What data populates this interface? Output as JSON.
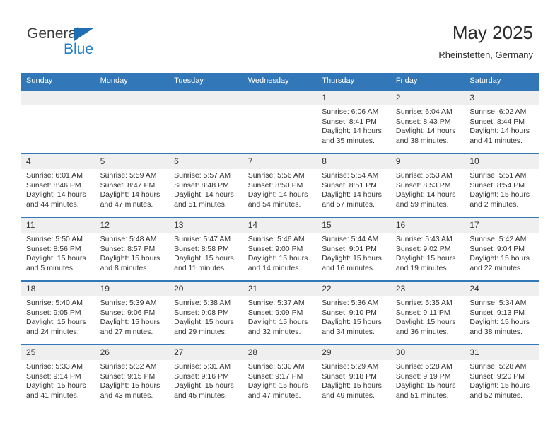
{
  "brand": {
    "name_part1": "General",
    "name_part2": "Blue"
  },
  "header": {
    "title": "May 2025",
    "subtitle": "Rheinstetten, Germany"
  },
  "colors": {
    "header_blue": "#3277b7",
    "logo_blue": "#2080d0",
    "daynum_band": "#efefef"
  },
  "weekday_headers": [
    "Sunday",
    "Monday",
    "Tuesday",
    "Wednesday",
    "Thursday",
    "Friday",
    "Saturday"
  ],
  "weeks": [
    [
      {
        "day": "",
        "sunrise": "",
        "sunset": "",
        "daylight_line1": "",
        "daylight_line2": ""
      },
      {
        "day": "",
        "sunrise": "",
        "sunset": "",
        "daylight_line1": "",
        "daylight_line2": ""
      },
      {
        "day": "",
        "sunrise": "",
        "sunset": "",
        "daylight_line1": "",
        "daylight_line2": ""
      },
      {
        "day": "",
        "sunrise": "",
        "sunset": "",
        "daylight_line1": "",
        "daylight_line2": ""
      },
      {
        "day": "1",
        "sunrise": "Sunrise: 6:06 AM",
        "sunset": "Sunset: 8:41 PM",
        "daylight_line1": "Daylight: 14 hours",
        "daylight_line2": "and 35 minutes."
      },
      {
        "day": "2",
        "sunrise": "Sunrise: 6:04 AM",
        "sunset": "Sunset: 8:43 PM",
        "daylight_line1": "Daylight: 14 hours",
        "daylight_line2": "and 38 minutes."
      },
      {
        "day": "3",
        "sunrise": "Sunrise: 6:02 AM",
        "sunset": "Sunset: 8:44 PM",
        "daylight_line1": "Daylight: 14 hours",
        "daylight_line2": "and 41 minutes."
      }
    ],
    [
      {
        "day": "4",
        "sunrise": "Sunrise: 6:01 AM",
        "sunset": "Sunset: 8:46 PM",
        "daylight_line1": "Daylight: 14 hours",
        "daylight_line2": "and 44 minutes."
      },
      {
        "day": "5",
        "sunrise": "Sunrise: 5:59 AM",
        "sunset": "Sunset: 8:47 PM",
        "daylight_line1": "Daylight: 14 hours",
        "daylight_line2": "and 47 minutes."
      },
      {
        "day": "6",
        "sunrise": "Sunrise: 5:57 AM",
        "sunset": "Sunset: 8:48 PM",
        "daylight_line1": "Daylight: 14 hours",
        "daylight_line2": "and 51 minutes."
      },
      {
        "day": "7",
        "sunrise": "Sunrise: 5:56 AM",
        "sunset": "Sunset: 8:50 PM",
        "daylight_line1": "Daylight: 14 hours",
        "daylight_line2": "and 54 minutes."
      },
      {
        "day": "8",
        "sunrise": "Sunrise: 5:54 AM",
        "sunset": "Sunset: 8:51 PM",
        "daylight_line1": "Daylight: 14 hours",
        "daylight_line2": "and 57 minutes."
      },
      {
        "day": "9",
        "sunrise": "Sunrise: 5:53 AM",
        "sunset": "Sunset: 8:53 PM",
        "daylight_line1": "Daylight: 14 hours",
        "daylight_line2": "and 59 minutes."
      },
      {
        "day": "10",
        "sunrise": "Sunrise: 5:51 AM",
        "sunset": "Sunset: 8:54 PM",
        "daylight_line1": "Daylight: 15 hours",
        "daylight_line2": "and 2 minutes."
      }
    ],
    [
      {
        "day": "11",
        "sunrise": "Sunrise: 5:50 AM",
        "sunset": "Sunset: 8:56 PM",
        "daylight_line1": "Daylight: 15 hours",
        "daylight_line2": "and 5 minutes."
      },
      {
        "day": "12",
        "sunrise": "Sunrise: 5:48 AM",
        "sunset": "Sunset: 8:57 PM",
        "daylight_line1": "Daylight: 15 hours",
        "daylight_line2": "and 8 minutes."
      },
      {
        "day": "13",
        "sunrise": "Sunrise: 5:47 AM",
        "sunset": "Sunset: 8:58 PM",
        "daylight_line1": "Daylight: 15 hours",
        "daylight_line2": "and 11 minutes."
      },
      {
        "day": "14",
        "sunrise": "Sunrise: 5:46 AM",
        "sunset": "Sunset: 9:00 PM",
        "daylight_line1": "Daylight: 15 hours",
        "daylight_line2": "and 14 minutes."
      },
      {
        "day": "15",
        "sunrise": "Sunrise: 5:44 AM",
        "sunset": "Sunset: 9:01 PM",
        "daylight_line1": "Daylight: 15 hours",
        "daylight_line2": "and 16 minutes."
      },
      {
        "day": "16",
        "sunrise": "Sunrise: 5:43 AM",
        "sunset": "Sunset: 9:02 PM",
        "daylight_line1": "Daylight: 15 hours",
        "daylight_line2": "and 19 minutes."
      },
      {
        "day": "17",
        "sunrise": "Sunrise: 5:42 AM",
        "sunset": "Sunset: 9:04 PM",
        "daylight_line1": "Daylight: 15 hours",
        "daylight_line2": "and 22 minutes."
      }
    ],
    [
      {
        "day": "18",
        "sunrise": "Sunrise: 5:40 AM",
        "sunset": "Sunset: 9:05 PM",
        "daylight_line1": "Daylight: 15 hours",
        "daylight_line2": "and 24 minutes."
      },
      {
        "day": "19",
        "sunrise": "Sunrise: 5:39 AM",
        "sunset": "Sunset: 9:06 PM",
        "daylight_line1": "Daylight: 15 hours",
        "daylight_line2": "and 27 minutes."
      },
      {
        "day": "20",
        "sunrise": "Sunrise: 5:38 AM",
        "sunset": "Sunset: 9:08 PM",
        "daylight_line1": "Daylight: 15 hours",
        "daylight_line2": "and 29 minutes."
      },
      {
        "day": "21",
        "sunrise": "Sunrise: 5:37 AM",
        "sunset": "Sunset: 9:09 PM",
        "daylight_line1": "Daylight: 15 hours",
        "daylight_line2": "and 32 minutes."
      },
      {
        "day": "22",
        "sunrise": "Sunrise: 5:36 AM",
        "sunset": "Sunset: 9:10 PM",
        "daylight_line1": "Daylight: 15 hours",
        "daylight_line2": "and 34 minutes."
      },
      {
        "day": "23",
        "sunrise": "Sunrise: 5:35 AM",
        "sunset": "Sunset: 9:11 PM",
        "daylight_line1": "Daylight: 15 hours",
        "daylight_line2": "and 36 minutes."
      },
      {
        "day": "24",
        "sunrise": "Sunrise: 5:34 AM",
        "sunset": "Sunset: 9:13 PM",
        "daylight_line1": "Daylight: 15 hours",
        "daylight_line2": "and 38 minutes."
      }
    ],
    [
      {
        "day": "25",
        "sunrise": "Sunrise: 5:33 AM",
        "sunset": "Sunset: 9:14 PM",
        "daylight_line1": "Daylight: 15 hours",
        "daylight_line2": "and 41 minutes."
      },
      {
        "day": "26",
        "sunrise": "Sunrise: 5:32 AM",
        "sunset": "Sunset: 9:15 PM",
        "daylight_line1": "Daylight: 15 hours",
        "daylight_line2": "and 43 minutes."
      },
      {
        "day": "27",
        "sunrise": "Sunrise: 5:31 AM",
        "sunset": "Sunset: 9:16 PM",
        "daylight_line1": "Daylight: 15 hours",
        "daylight_line2": "and 45 minutes."
      },
      {
        "day": "28",
        "sunrise": "Sunrise: 5:30 AM",
        "sunset": "Sunset: 9:17 PM",
        "daylight_line1": "Daylight: 15 hours",
        "daylight_line2": "and 47 minutes."
      },
      {
        "day": "29",
        "sunrise": "Sunrise: 5:29 AM",
        "sunset": "Sunset: 9:18 PM",
        "daylight_line1": "Daylight: 15 hours",
        "daylight_line2": "and 49 minutes."
      },
      {
        "day": "30",
        "sunrise": "Sunrise: 5:28 AM",
        "sunset": "Sunset: 9:19 PM",
        "daylight_line1": "Daylight: 15 hours",
        "daylight_line2": "and 51 minutes."
      },
      {
        "day": "31",
        "sunrise": "Sunrise: 5:28 AM",
        "sunset": "Sunset: 9:20 PM",
        "daylight_line1": "Daylight: 15 hours",
        "daylight_line2": "and 52 minutes."
      }
    ]
  ]
}
